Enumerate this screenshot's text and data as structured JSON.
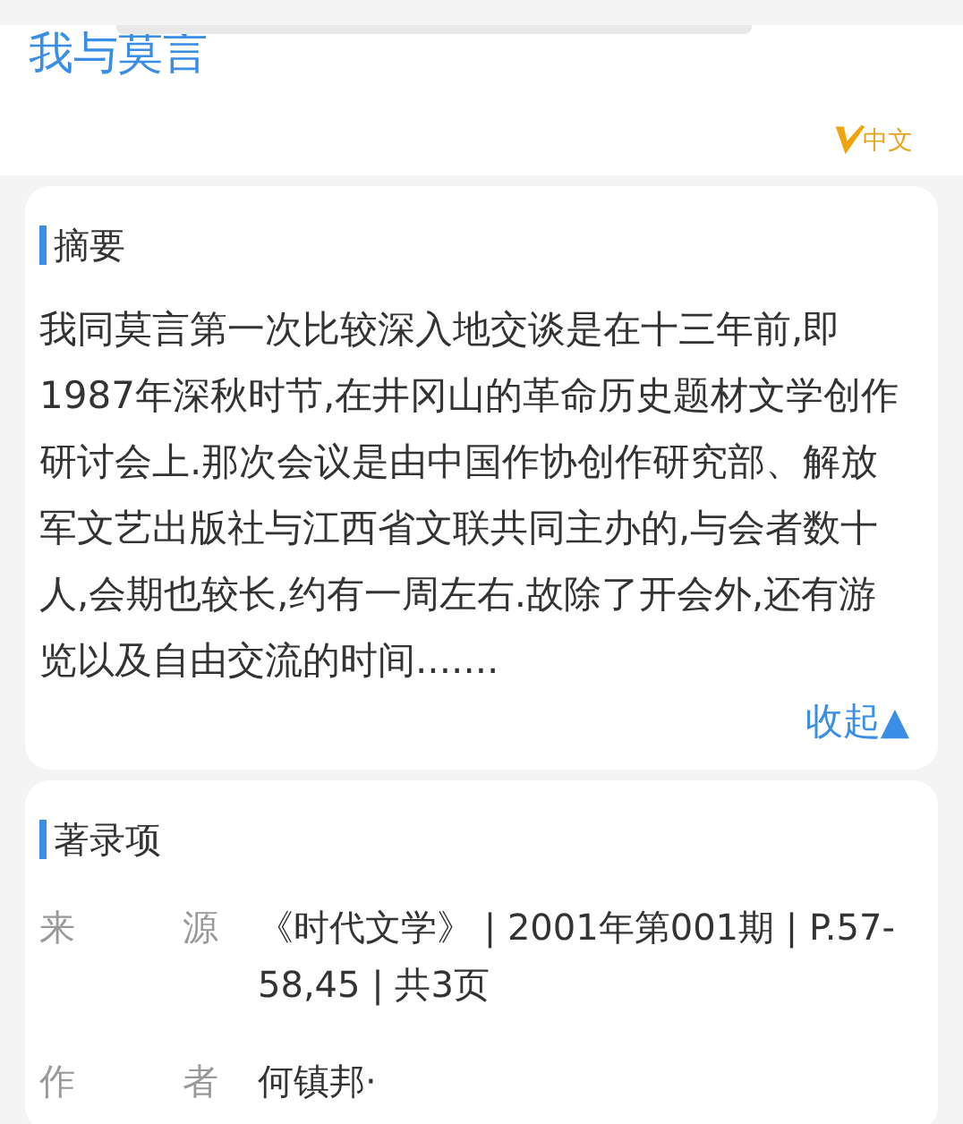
{
  "title": "我与莫言",
  "logo": {
    "text": "中文"
  },
  "abstract": {
    "heading": "摘要",
    "text": "我同莫言第一次比较深入地交谈是在十三年前,即1987年深秋时节,在井冈山的革命历史题材文学创作研讨会上.那次会议是由中国作协创作研究部、解放军文艺出版社与江西省文联共同主办的,与会者数十人,会期也较长,约有一周左右.故除了开会外,还有游览以及自由交流的时间.......",
    "toggle": "收起▲"
  },
  "record": {
    "heading": "著录项",
    "rows": [
      {
        "label": "来源",
        "value": "《时代文学》 | 2001年第001期 | P.57-58,45 | 共3页"
      },
      {
        "label": "作者",
        "value": "何镇邦·"
      }
    ]
  }
}
